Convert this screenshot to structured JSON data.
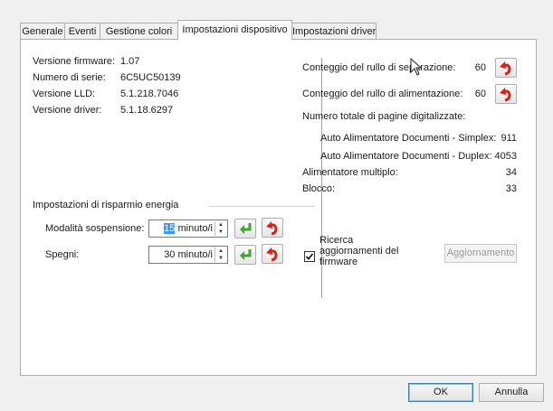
{
  "tabs": [
    {
      "label": "Generale"
    },
    {
      "label": "Eventi"
    },
    {
      "label": "Gestione colori"
    },
    {
      "label": "Impostazioni dispositivo"
    },
    {
      "label": "Impostazioni driver"
    }
  ],
  "active_tab": "Impostazioni dispositivo",
  "device_info": {
    "firmware_label": "Versione firmware:",
    "firmware_value": "1.07",
    "serial_label": "Numero di serie:",
    "serial_value": "6C5UC50139",
    "lld_label": "Versione LLD:",
    "lld_value": "5.1.218.7046",
    "driver_label": "Versione driver:",
    "driver_value": "5.1.18.6297"
  },
  "power_saving": {
    "group_title": "Impostazioni di risparmio energia",
    "sleep_label": "Modalità sospensione:",
    "sleep_value_selected": "15",
    "sleep_unit": " minuto/i",
    "off_label": "Spegni:",
    "off_value": "30 minuto/i"
  },
  "counters": {
    "separation_roller_label": "Conteggio del rullo di separazione:",
    "separation_roller_value": "60",
    "feed_roller_label": "Conteggio del rullo di alimentazione:",
    "feed_roller_value": "60",
    "total_pages_label": "Numero totale di pagine digitalizzate:",
    "adf_simplex_label": "Auto Alimentatore Documenti - Simplex:",
    "adf_simplex_value": "911",
    "adf_duplex_label": "Auto Alimentatore Documenti - Duplex:",
    "adf_duplex_value": "4053",
    "multifeed_label": "Alimentatore multiplo:",
    "multifeed_value": "34",
    "jam_label": "Blocco:",
    "jam_value": "33"
  },
  "firmware_update": {
    "check_label_1": "Ricerca",
    "check_label_2": "aggiornamenti del",
    "check_label_3": "firmware",
    "checked": true,
    "update_button": "Aggiornamento"
  },
  "footer": {
    "ok_label": "OK",
    "cancel_label": "Annulla"
  },
  "icons": {
    "apply": "green-return-arrow-icon",
    "reset": "red-undo-arrow-icon"
  },
  "colors": {
    "reset_red": "#d9221c",
    "apply_green": "#3ea82a",
    "selection_blue": "#3399ff"
  }
}
